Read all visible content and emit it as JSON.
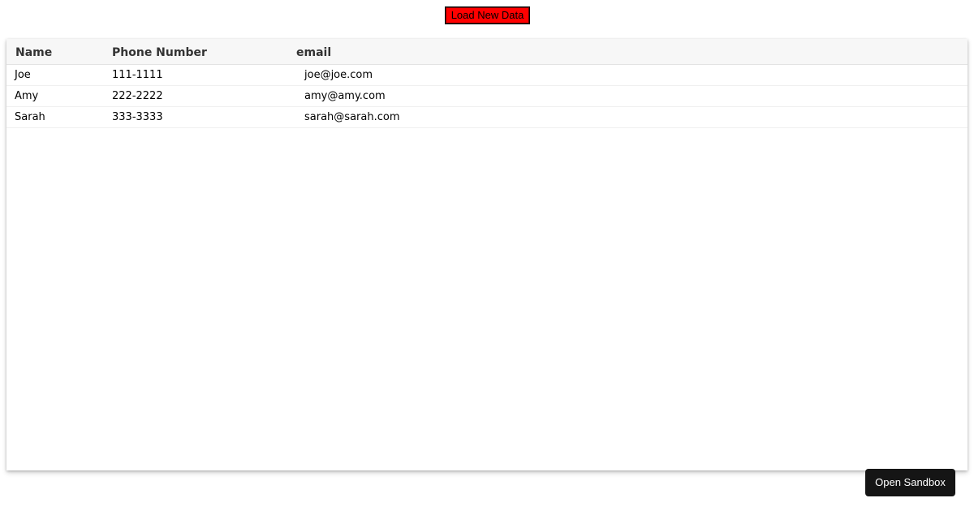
{
  "toolbar": {
    "load_label": "Load New Data",
    "load_color": "#ff0000"
  },
  "table": {
    "columns": [
      "Name",
      "Phone Number",
      "email"
    ],
    "rows": [
      [
        "Joe",
        "111-1111",
        "joe@joe.com"
      ],
      [
        "Amy",
        "222-2222",
        "amy@amy.com"
      ],
      [
        "Sarah",
        "333-3333",
        "sarah@sarah.com"
      ]
    ]
  },
  "sandbox": {
    "label": "Open Sandbox",
    "color": "#151515"
  }
}
